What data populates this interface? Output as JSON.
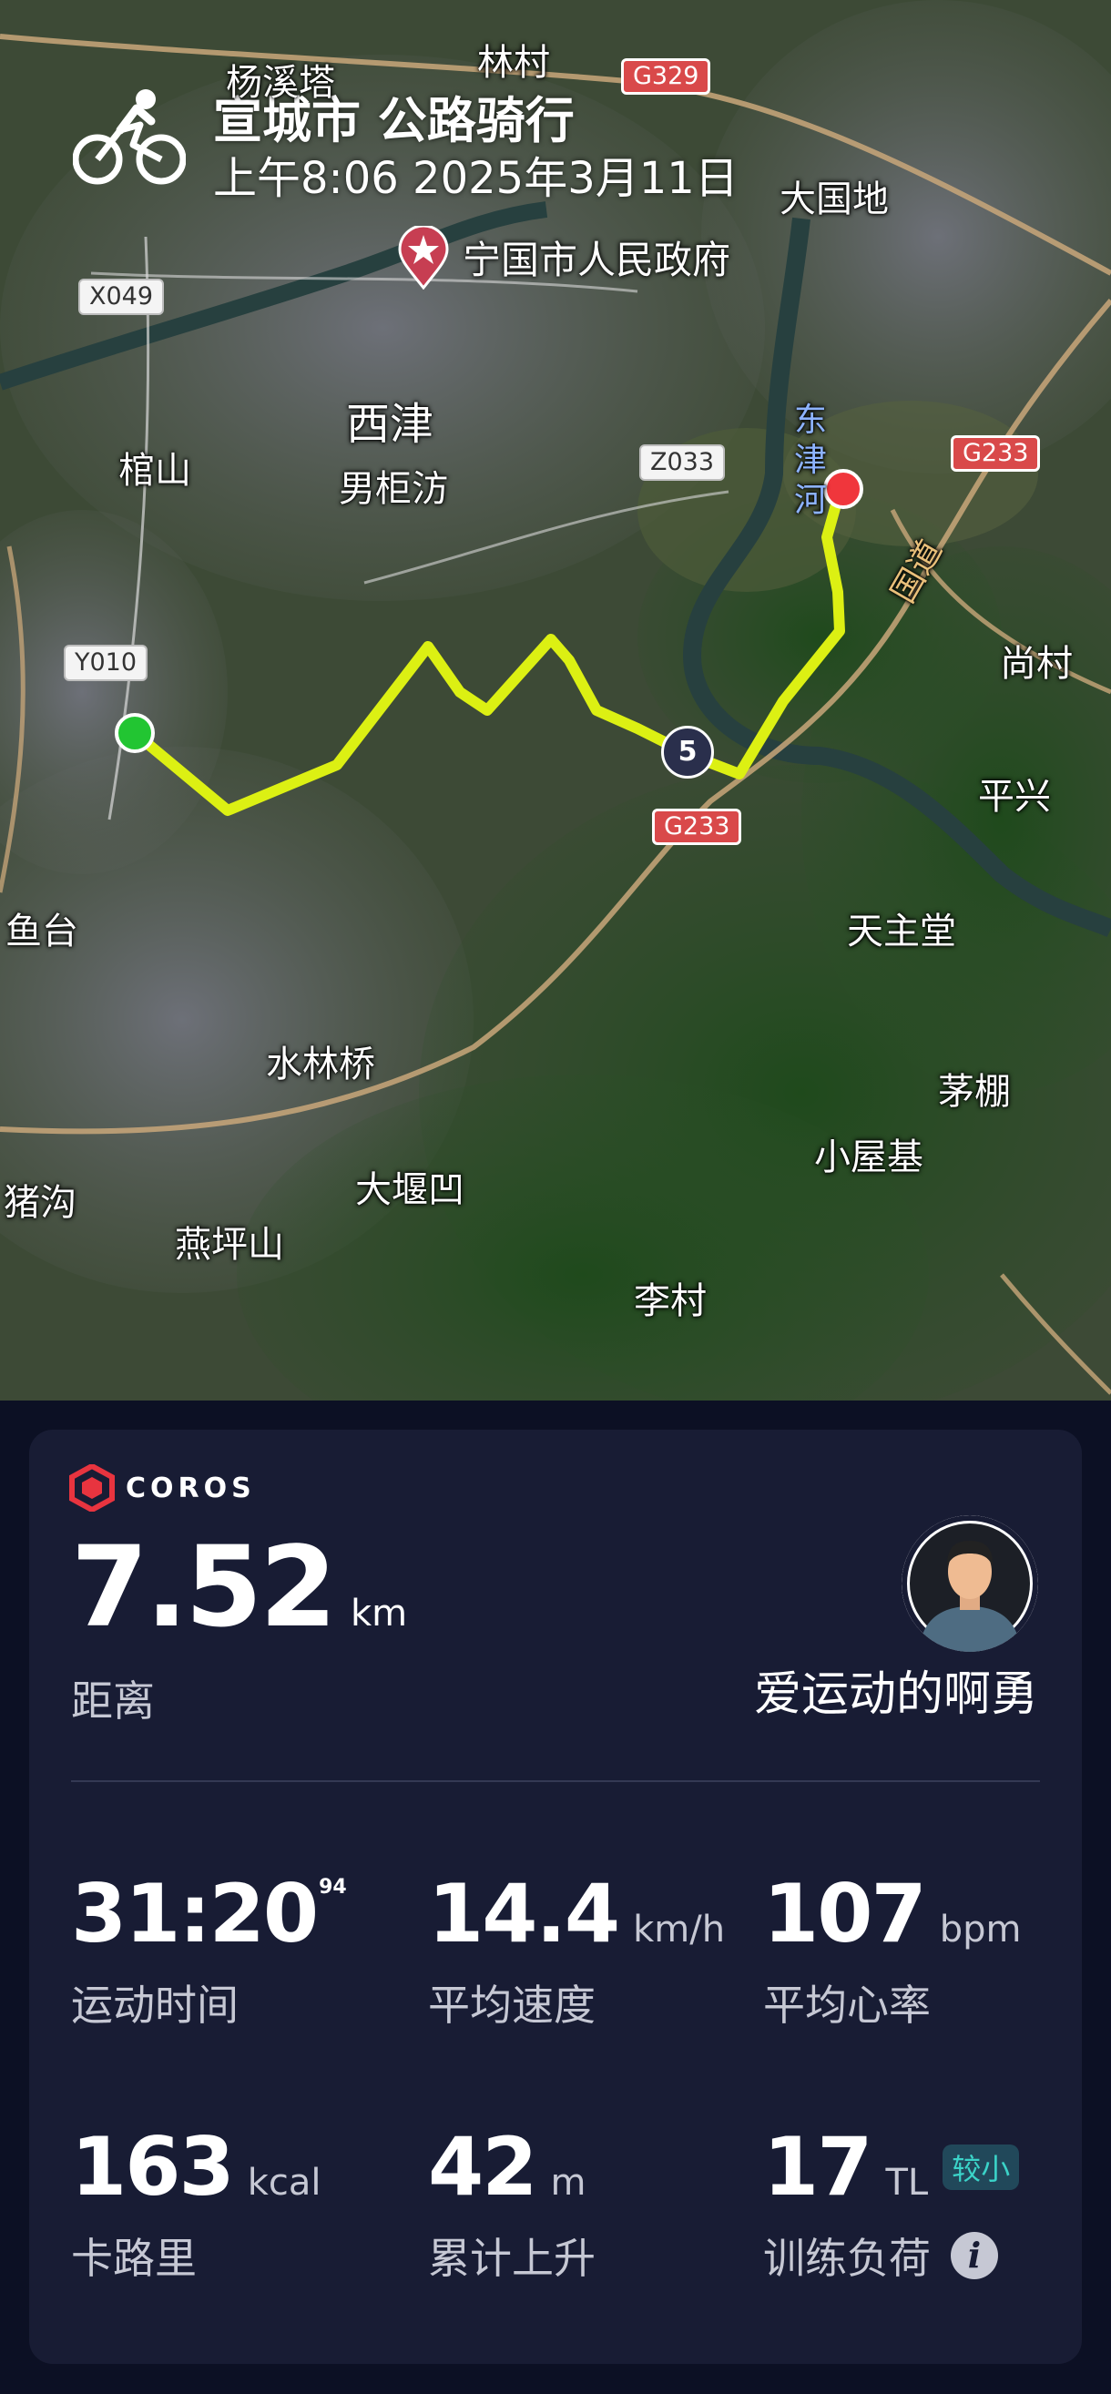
{
  "header": {
    "title": "宣城市 公路骑行",
    "datetime": "上午8:06 2025年3月11日"
  },
  "map": {
    "government": "宁国市人民政府",
    "places": {
      "yangxi": "杨溪塔",
      "lincun": "林村",
      "daguodi": "大国地",
      "xijin": "西津",
      "guanshan": "棺山",
      "nanjufang": "男柜汸",
      "shangcun": "尚村",
      "pingxing": "平兴",
      "tianzhutang": "天主堂",
      "yutai": "鱼台",
      "shuilinqiao": "水林桥",
      "maopeng": "茅棚",
      "xiaowuji": "小屋基",
      "dayanao": "大堰凹",
      "zhugou": "猪沟",
      "yanpingshan": "燕坪山",
      "licun": "李村",
      "river": "东津河",
      "national_road": "国道"
    },
    "roads": {
      "g329": "G329",
      "g233_top": "G233",
      "g233_bottom": "G233",
      "x049": "X049",
      "z033": "Z033",
      "y010": "Y010"
    },
    "km_marker": "5",
    "route_color": "#dcf013",
    "start_color": "#22c532",
    "end_color": "#f0363c"
  },
  "summary": {
    "brand": "COROS",
    "distance_value": "7.52",
    "distance_unit": "km",
    "distance_label": "距离",
    "username": "爱运动的啊勇",
    "stats": [
      {
        "value": "31:20",
        "sup": "94",
        "unit": "",
        "label": "运动时间"
      },
      {
        "value": "14.4",
        "unit": "km/h",
        "label": "平均速度"
      },
      {
        "value": "107",
        "unit": "bpm",
        "label": "平均心率"
      },
      {
        "value": "163",
        "unit": "kcal",
        "label": "卡路里"
      },
      {
        "value": "42",
        "unit": "m",
        "label": "累计上升"
      },
      {
        "value": "17",
        "unit": "TL",
        "badge": "较小",
        "label": "训练负荷"
      }
    ],
    "info_icon": "info-icon"
  }
}
